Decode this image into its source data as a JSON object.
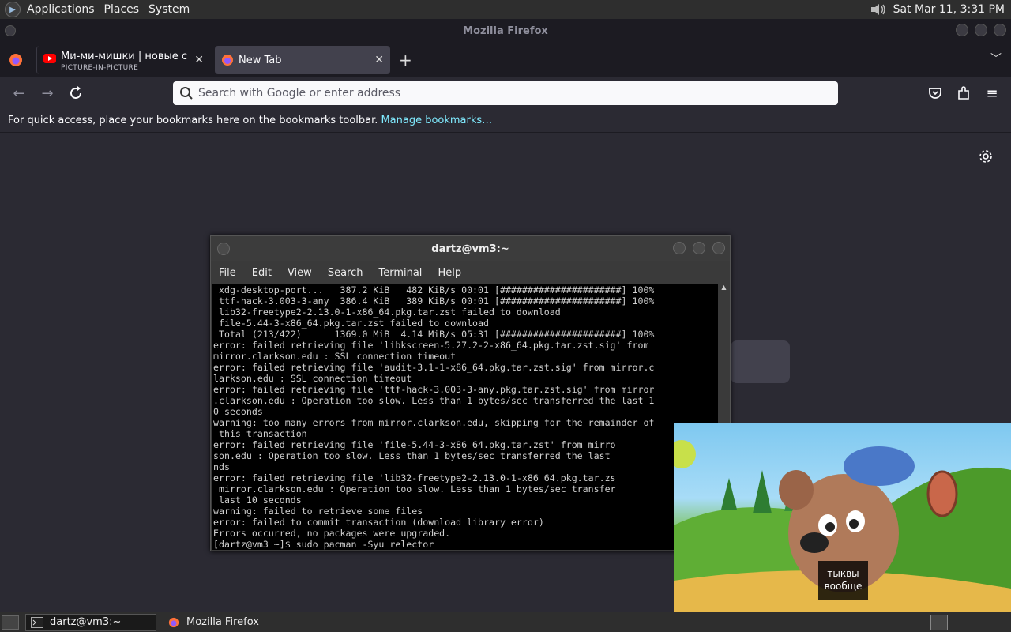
{
  "top_panel": {
    "menus": [
      "Applications",
      "Places",
      "System"
    ],
    "clock": "Sat Mar 11,  3:31 PM",
    "icons": [
      "gnome-foot-icon",
      "volume-icon"
    ]
  },
  "firefox": {
    "window_title": "Mozilla Firefox",
    "tabs": [
      {
        "label": "Ми-ми-мишки | новые серии",
        "sublabel": "PICTURE-IN-PICTURE",
        "icon": "youtube-icon"
      },
      {
        "label": "New Tab",
        "icon": "firefox-icon"
      }
    ],
    "urlbar_placeholder": "Search with Google or enter address",
    "bookmarks_text": "For quick access, place your bookmarks here on the bookmarks toolbar.",
    "bookmarks_link": "Manage bookmarks…",
    "accent": "#80ebff"
  },
  "terminal": {
    "title": "dartz@vm3:~",
    "menu": [
      "File",
      "Edit",
      "View",
      "Search",
      "Terminal",
      "Help"
    ],
    "output": " xdg-desktop-port...   387.2 KiB   482 KiB/s 00:01 [######################] 100%\n ttf-hack-3.003-3-any  386.4 KiB   389 KiB/s 00:01 [######################] 100%\n lib32-freetype2-2.13.0-1-x86_64.pkg.tar.zst failed to download\n file-5.44-3-x86_64.pkg.tar.zst failed to download\n Total (213/422)      1369.0 MiB  4.14 MiB/s 05:31 [######################] 100%\nerror: failed retrieving file 'libkscreen-5.27.2-2-x86_64.pkg.tar.zst.sig' from\nmirror.clarkson.edu : SSL connection timeout\nerror: failed retrieving file 'audit-3.1-1-x86_64.pkg.tar.zst.sig' from mirror.c\nlarkson.edu : SSL connection timeout\nerror: failed retrieving file 'ttf-hack-3.003-3-any.pkg.tar.zst.sig' from mirror\n.clarkson.edu : Operation too slow. Less than 1 bytes/sec transferred the last 1\n0 seconds\nwarning: too many errors from mirror.clarkson.edu, skipping for the remainder of\n this transaction\nerror: failed retrieving file 'file-5.44-3-x86_64.pkg.tar.zst' from mirro\nson.edu : Operation too slow. Less than 1 bytes/sec transferred the last\nnds\nerror: failed retrieving file 'lib32-freetype2-2.13.0-1-x86_64.pkg.tar.zs\n mirror.clarkson.edu : Operation too slow. Less than 1 bytes/sec transfer\n last 10 seconds\nwarning: failed to retrieve some files\nerror: failed to commit transaction (download library error)\nErrors occurred, no packages were upgraded.\n[dartz@vm3 ~]$ sudo pacman -Syu relector"
  },
  "pip": {
    "subtitle_line1": "тыквы",
    "subtitle_line2": "вообще"
  },
  "taskbar": {
    "items": [
      {
        "label": "dartz@vm3:~",
        "icon": "terminal-icon"
      },
      {
        "label": "Mozilla Firefox",
        "icon": "firefox-icon"
      }
    ]
  }
}
